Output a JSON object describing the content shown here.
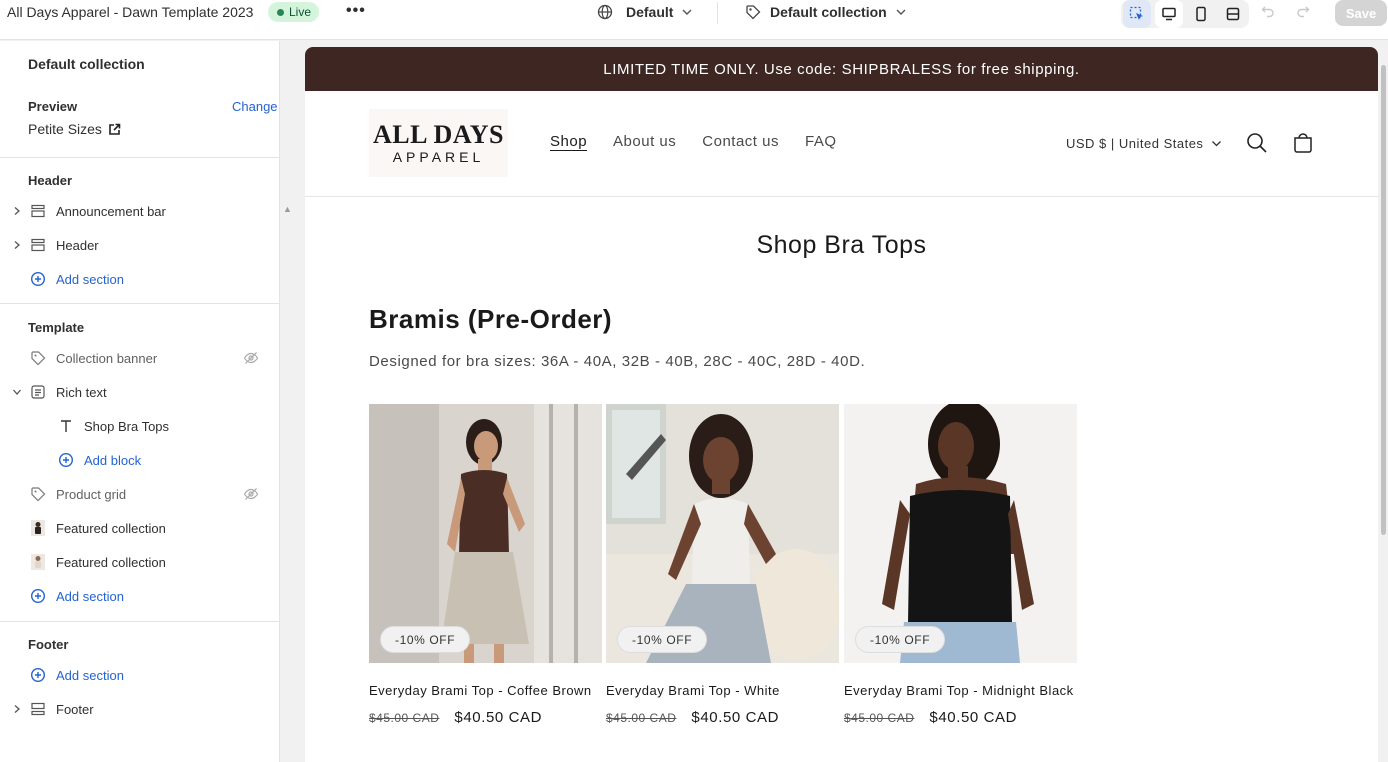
{
  "topbar": {
    "store_title": "All Days Apparel - Dawn Template 2023",
    "status": "Live",
    "more": "•••",
    "theme_selector": "Default",
    "template_selector": "Default collection",
    "save": "Save"
  },
  "sidebar": {
    "title": "Default collection",
    "preview_label": "Preview",
    "preview_change": "Change",
    "preview_value": "Petite Sizes",
    "header_group": "Header",
    "header_items": [
      {
        "label": "Announcement bar"
      },
      {
        "label": "Header"
      }
    ],
    "header_add": "Add section",
    "template_group": "Template",
    "template_items": [
      {
        "label": "Collection banner"
      },
      {
        "label": "Rich text"
      },
      {
        "label": "Shop Bra Tops"
      },
      {
        "label": "Add block"
      },
      {
        "label": "Product grid"
      },
      {
        "label": "Featured collection"
      },
      {
        "label": "Featured collection"
      }
    ],
    "template_add": "Add section",
    "footer_group": "Footer",
    "footer_add": "Add section",
    "footer_items": [
      {
        "label": "Footer"
      }
    ]
  },
  "preview": {
    "announcement": "LIMITED TIME ONLY. Use code: SHIPBRALESS for free shipping.",
    "logo_line1": "ALL DAYS",
    "logo_line2": "APPAREL",
    "nav": [
      "Shop",
      "About us",
      "Contact us",
      "FAQ"
    ],
    "currency": "USD $ | United States",
    "page_title": "Shop Bra Tops",
    "collection_title": "Bramis (Pre-Order)",
    "collection_desc": "Designed for bra sizes: 36A - 40A, 32B - 40B, 28C - 40C, 28D - 40D.",
    "products": [
      {
        "name": "Everyday Brami Top - Coffee Brown",
        "old_price": "$45.00 CAD",
        "price": "$40.50 CAD",
        "badge": "-10% OFF"
      },
      {
        "name": "Everyday Brami Top - White",
        "old_price": "$45.00 CAD",
        "price": "$40.50 CAD",
        "badge": "-10% OFF"
      },
      {
        "name": "Everyday Brami Top - Midnight Black",
        "old_price": "$45.00 CAD",
        "price": "$40.50 CAD",
        "badge": "-10% OFF"
      }
    ]
  },
  "colors": {
    "announcement_bg": "#3e2723",
    "link_blue": "#2463d1",
    "live_green": "#29845a"
  }
}
